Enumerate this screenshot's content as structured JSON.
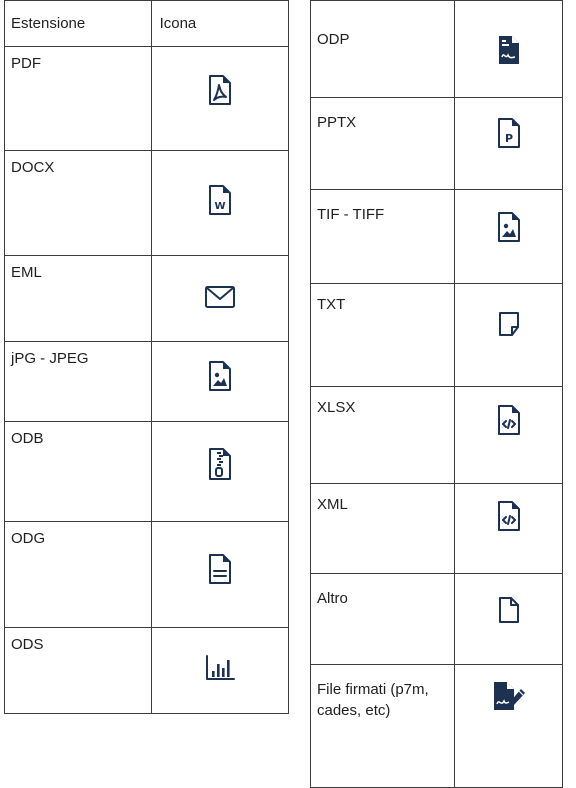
{
  "left_table": {
    "header": {
      "extension": "Estensione",
      "icon": "Icona"
    },
    "rows": [
      {
        "extension": "PDF",
        "icon": "pdf-file-icon"
      },
      {
        "extension": "DOCX",
        "icon": "word-file-icon"
      },
      {
        "extension": "EML",
        "icon": "envelope-icon"
      },
      {
        "extension": "jPG - JPEG",
        "icon": "image-file-icon"
      },
      {
        "extension": "ODB",
        "icon": "zip-file-icon"
      },
      {
        "extension": "ODG",
        "icon": "text-file-icon"
      },
      {
        "extension": "ODS",
        "icon": "bar-chart-icon"
      }
    ]
  },
  "right_table": {
    "rows": [
      {
        "extension": "ODP",
        "icon": "signature-file-icon"
      },
      {
        "extension": "PPTX",
        "icon": "powerpoint-file-icon"
      },
      {
        "extension": "TIF - TIFF",
        "icon": "image-file-icon"
      },
      {
        "extension": "TXT",
        "icon": "note-icon"
      },
      {
        "extension": "XLSX",
        "icon": "code-file-icon"
      },
      {
        "extension": "XML",
        "icon": "code-file-icon"
      },
      {
        "extension": "Altro",
        "icon": "blank-file-icon"
      },
      {
        "extension": "File firmati (p7m, cades, etc)",
        "icon": "signed-document-icon"
      }
    ]
  },
  "colors": {
    "icon": "#1d3151",
    "border": "#3c3c3c"
  }
}
